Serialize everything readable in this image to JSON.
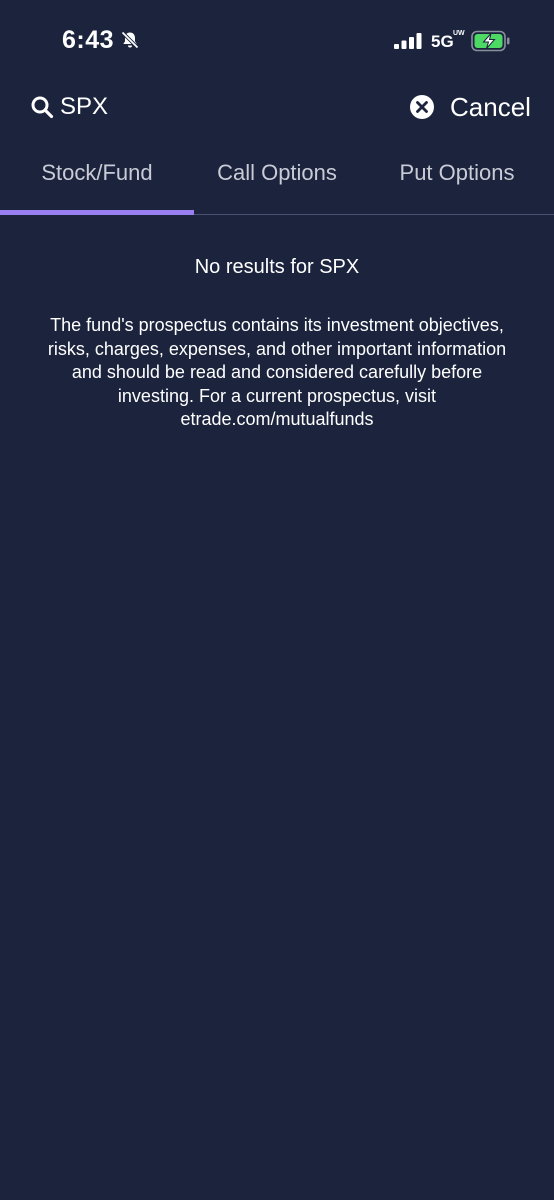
{
  "status_bar": {
    "time": "6:43",
    "network": "5G",
    "network_sub": "UW",
    "icons": [
      "bell-slash-icon",
      "signal-icon",
      "battery-charging-icon"
    ]
  },
  "search": {
    "query": "SPX",
    "cancel_label": "Cancel",
    "icons": [
      "search-icon",
      "clear-icon"
    ]
  },
  "tabs": [
    {
      "label": "Stock/Fund",
      "active": true
    },
    {
      "label": "Call Options",
      "active": false
    },
    {
      "label": "Put Options",
      "active": false
    }
  ],
  "content": {
    "no_results": "No results for SPX",
    "disclaimer": "The fund's prospectus contains its investment objectives, risks, charges, expenses, and other important information and should be read and considered carefully before investing. For a current prospectus, visit etrade.com/mutualfunds"
  },
  "colors": {
    "background": "#1b233d",
    "active_tab_indicator": "#9a7ff2",
    "battery_fill": "#4cd964"
  }
}
